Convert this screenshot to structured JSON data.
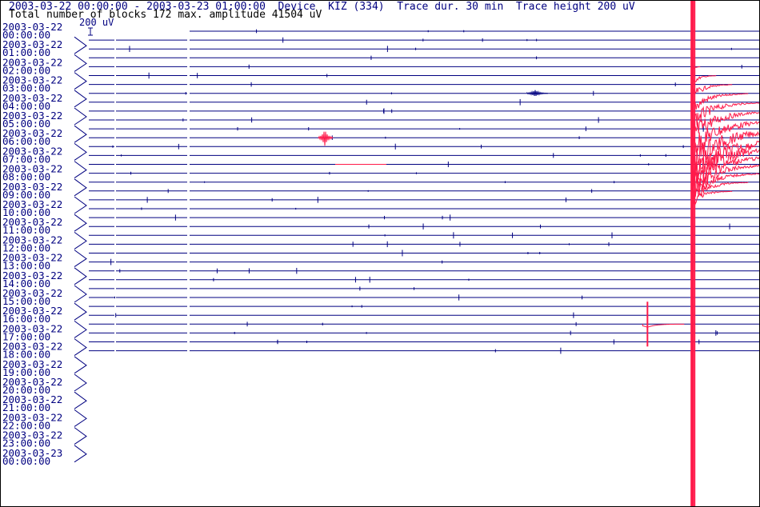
{
  "header": {
    "line1": "2003-03-22 00:00:00 - 2003-03-23 01:00:00  Device  KIZ (334)  Trace dur. 30 min  Trace height 200 uV",
    "line2": "Total number of blocks 172 max. amplitude 41504 uV",
    "scale_label": "200 uV"
  },
  "colors": {
    "trace": "#000080",
    "event": "#ff1a4a",
    "text": "#000080"
  },
  "chart_data": {
    "type": "line",
    "title": "2003-03-22 00:00:00 - 2003-03-23 01:00:00  Device  KIZ (334)  Trace dur. 30 min  Trace height 200 uV",
    "subtitle": "Total number of blocks 172 max. amplitude 41504 uV",
    "trace_duration_min": 30,
    "trace_height_uV": 200,
    "max_amplitude_uV": 41504,
    "blocks": 172,
    "y_tick_labels": [
      [
        "2003-03-22",
        "00:00:00"
      ],
      [
        "2003-03-22",
        "01:00:00"
      ],
      [
        "2003-03-22",
        "02:00:00"
      ],
      [
        "2003-03-22",
        "03:00:00"
      ],
      [
        "2003-03-22",
        "04:00:00"
      ],
      [
        "2003-03-22",
        "05:00:00"
      ],
      [
        "2003-03-22",
        "06:00:00"
      ],
      [
        "2003-03-22",
        "07:00:00"
      ],
      [
        "2003-03-22",
        "08:00:00"
      ],
      [
        "2003-03-22",
        "09:00:00"
      ],
      [
        "2003-03-22",
        "10:00:00"
      ],
      [
        "2003-03-22",
        "11:00:00"
      ],
      [
        "2003-03-22",
        "12:00:00"
      ],
      [
        "2003-03-22",
        "13:00:00"
      ],
      [
        "2003-03-22",
        "14:00:00"
      ],
      [
        "2003-03-22",
        "15:00:00"
      ],
      [
        "2003-03-22",
        "16:00:00"
      ],
      [
        "2003-03-22",
        "17:00:00"
      ],
      [
        "2003-03-22",
        "18:00:00"
      ],
      [
        "2003-03-22",
        "19:00:00"
      ],
      [
        "2003-03-22",
        "20:00:00"
      ],
      [
        "2003-03-22",
        "21:00:00"
      ],
      [
        "2003-03-22",
        "22:00:00"
      ],
      [
        "2003-03-22",
        "23:00:00"
      ],
      [
        "2003-03-23",
        "00:00:00"
      ]
    ],
    "trace_start_min": 0,
    "trace_end_min": 1110,
    "main_event": {
      "start_min": 387,
      "peak_uV": 41504
    },
    "secondary_event": {
      "start_min": 1015,
      "peak_uV": 6000
    }
  }
}
